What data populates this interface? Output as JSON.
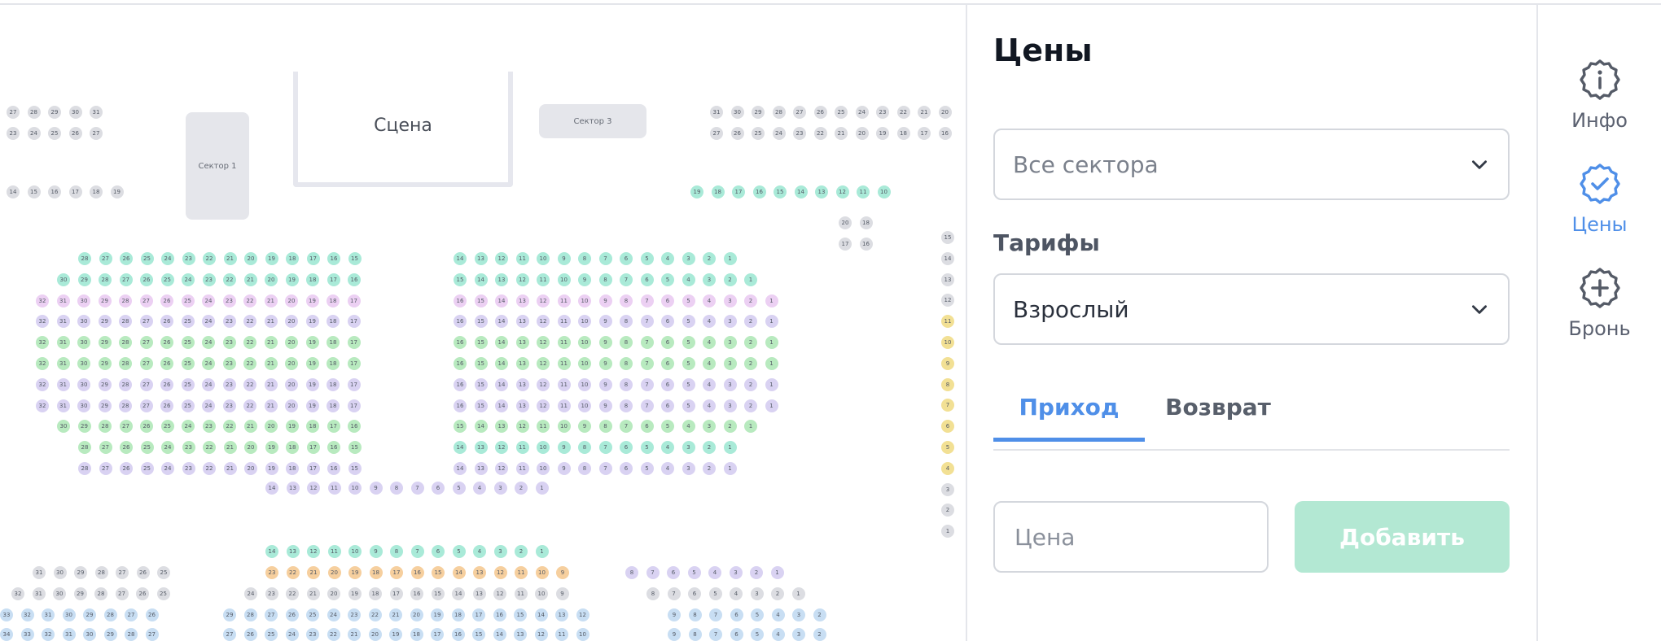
{
  "seatmap": {
    "stage_label": "Сцена",
    "sectors": {
      "sector1": "Сектор 1",
      "sector3": "Сектор 3"
    },
    "colors": {
      "gray": "#dcdde2",
      "teal": "#a9ead8",
      "green": "#b8eabf",
      "purple": "#d9d2f2",
      "pink": "#ecd0f3",
      "yellow": "#f2e094",
      "orange": "#f6cf9e",
      "blue": "#c8def3"
    }
  },
  "panel": {
    "title": "Цены",
    "sectors_select": {
      "value": "Все сектора"
    },
    "tariffs_label": "Тарифы",
    "tariffs_select": {
      "value": "Взрослый"
    },
    "tabs": [
      {
        "label": "Приход",
        "active": true
      },
      {
        "label": "Возврат",
        "active": false
      }
    ],
    "price_input": {
      "placeholder": "Цена"
    },
    "add_button": {
      "label": "Добавить",
      "accent": "#b3e8d3"
    },
    "accent_color": "#4f8fe8"
  },
  "rail": {
    "items": [
      {
        "label": "Инфо",
        "icon": "info-icon",
        "active": false
      },
      {
        "label": "Цены",
        "icon": "price-check-icon",
        "active": true
      },
      {
        "label": "Бронь",
        "icon": "add-booking-icon",
        "active": false
      }
    ]
  }
}
